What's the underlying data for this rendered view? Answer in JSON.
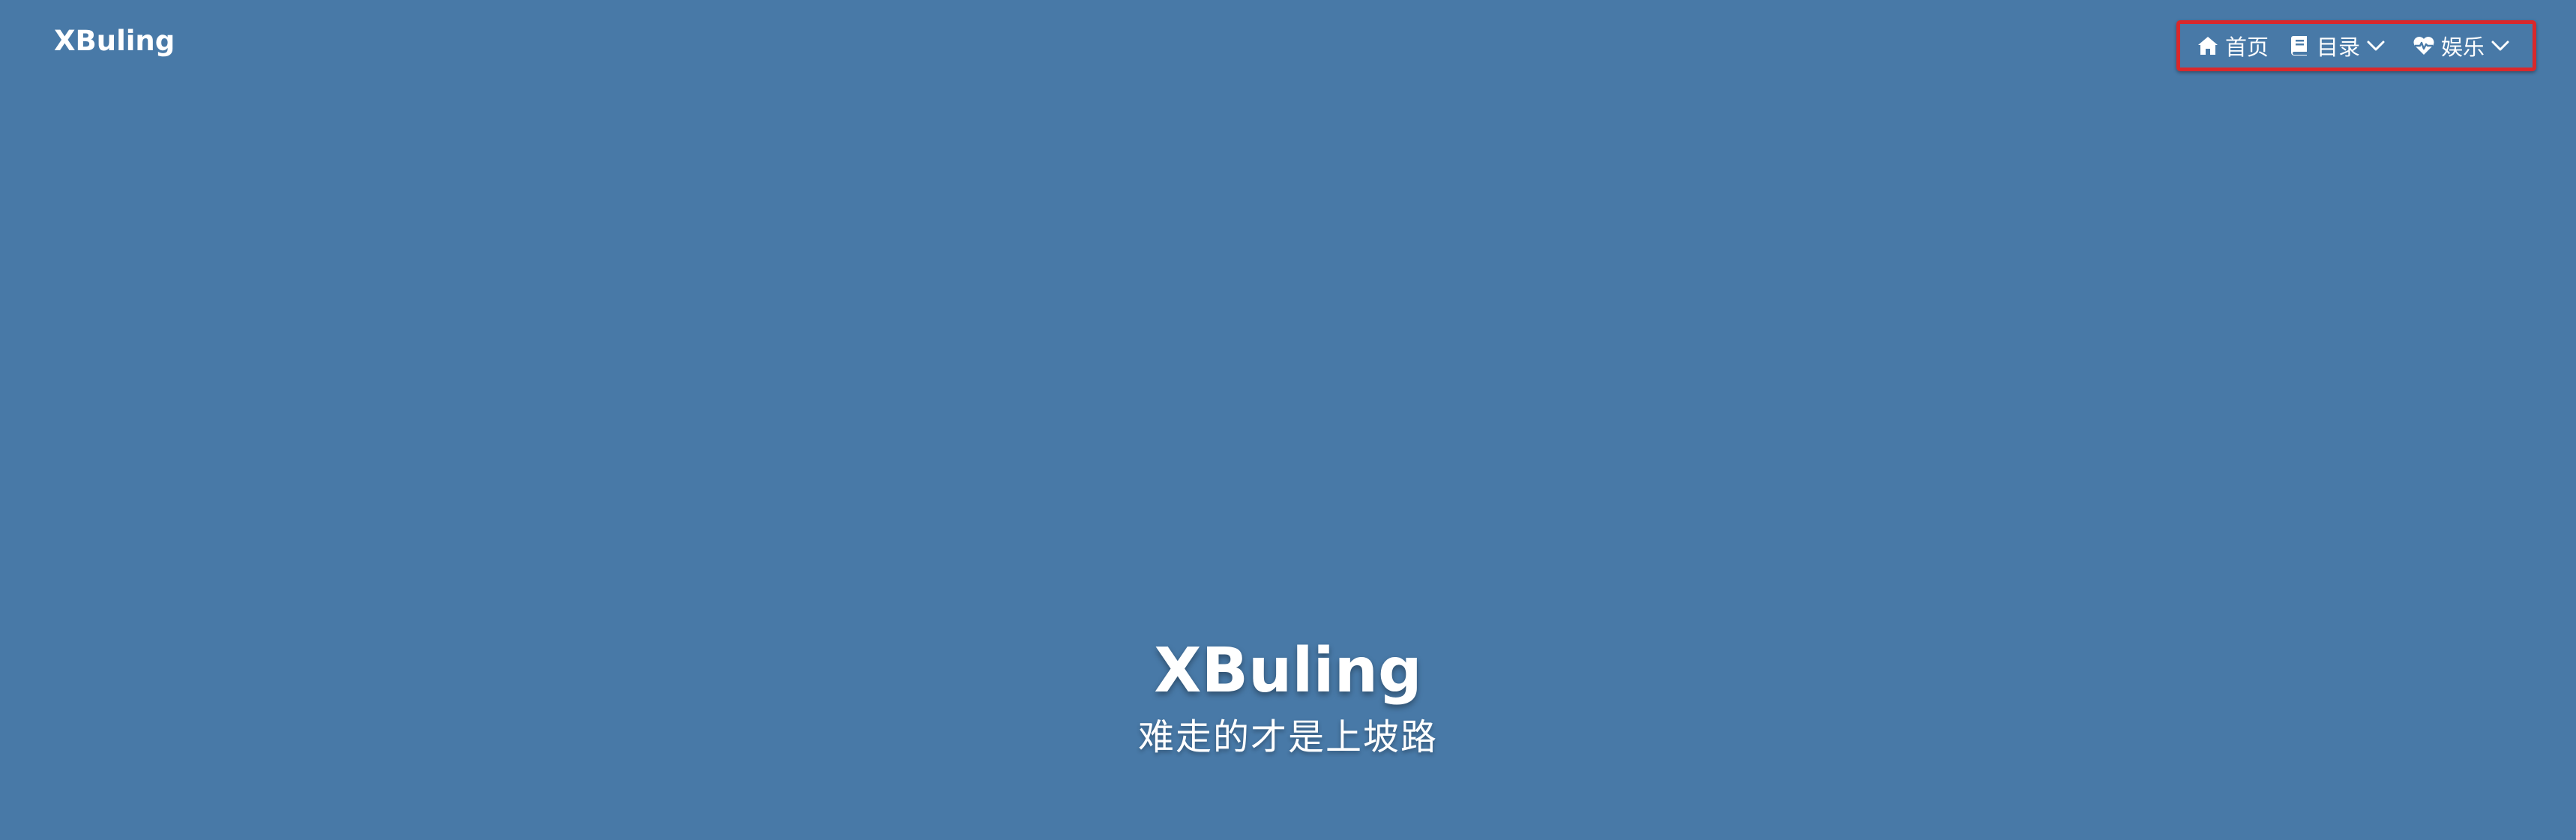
{
  "header": {
    "site_title": "XBuling"
  },
  "nav": {
    "items": [
      {
        "label": "首页",
        "icon": "home-icon"
      },
      {
        "label": "目录",
        "icon": "book-icon",
        "dropdown": true
      },
      {
        "label": "娱乐",
        "icon": "heartbeat-icon",
        "dropdown": true
      }
    ],
    "highlight_color": "#d9282b"
  },
  "hero": {
    "title": "XBuling",
    "subtitle": "难走的才是上坡路"
  },
  "colors": {
    "background": "#4879a7",
    "text": "#ffffff"
  }
}
